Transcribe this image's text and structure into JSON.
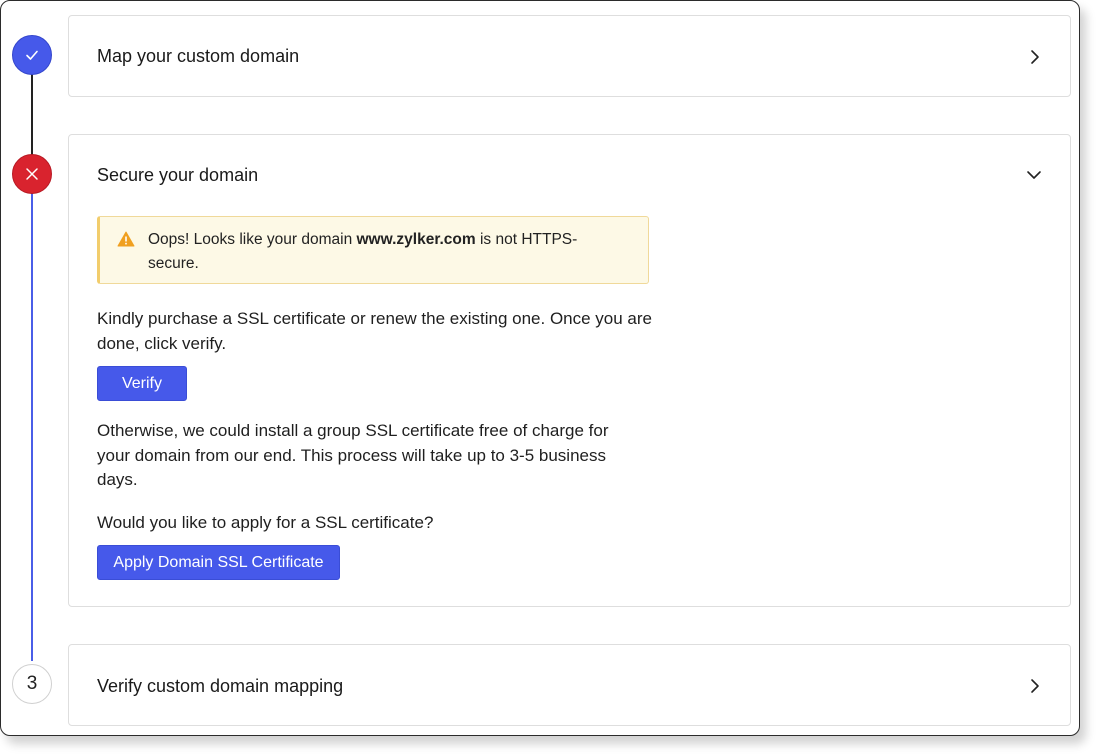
{
  "steps": [
    {
      "status": "done",
      "icon": "check-icon",
      "title": "Map your custom domain",
      "expanded": false
    },
    {
      "status": "error",
      "icon": "close-icon",
      "title": "Secure your domain",
      "expanded": true,
      "alert": {
        "prefix": "Oops! Looks like your domain ",
        "domain": "www.zylker.com",
        "suffix": " is not HTTPS-secure.",
        "icon": "warning-icon"
      },
      "instruction": "Kindly purchase a SSL certificate or renew the existing one. Once you are done, click verify.",
      "verify_label": "Verify",
      "otherwise_text": "Otherwise, we could install a group SSL certificate free of charge for your domain from our end. This process will take up to 3-5 business days.",
      "question": "Would you like to apply for a SSL certificate?",
      "apply_label": "Apply Domain SSL Certificate"
    },
    {
      "status": "pending",
      "number": "3",
      "title": "Verify custom domain mapping",
      "expanded": false
    }
  ],
  "colors": {
    "accent": "#4659ea",
    "error": "#d9232e",
    "warning_bg": "#fdf9e6",
    "warning_icon": "#f0a020"
  }
}
